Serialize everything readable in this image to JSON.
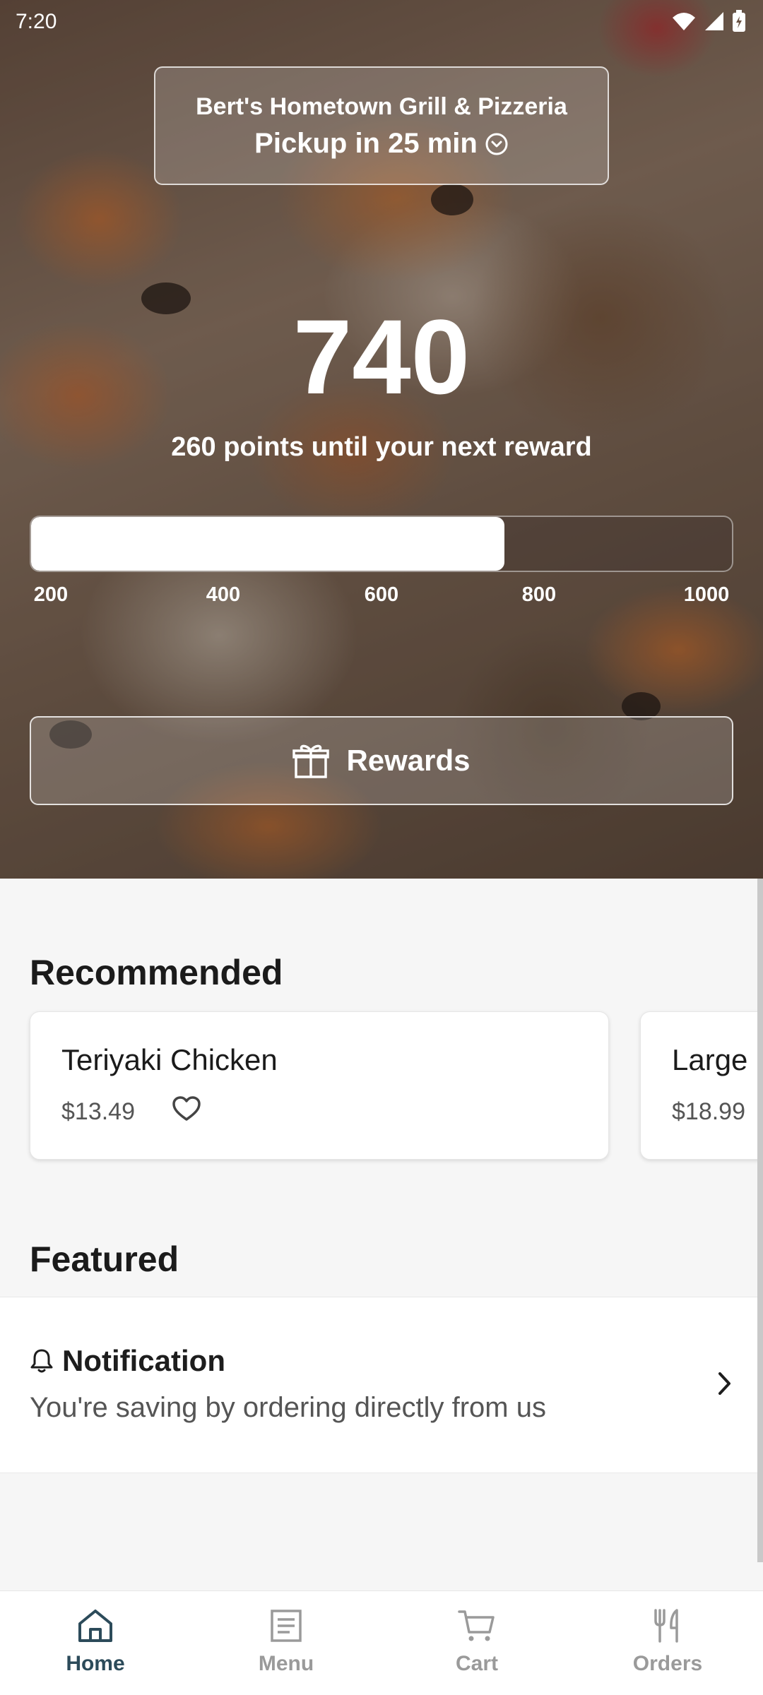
{
  "status_bar": {
    "time": "7:20"
  },
  "store": {
    "name": "Bert's Hometown Grill & Pizzeria",
    "pickup": "Pickup in 25 min"
  },
  "loyalty": {
    "points": "740",
    "subtitle": "260 points until your next reward",
    "progress": {
      "current": 740,
      "min": 200,
      "max": 1000
    },
    "ticks": [
      "200",
      "400",
      "600",
      "800",
      "1000"
    ]
  },
  "rewards_button": {
    "label": "Rewards"
  },
  "recommended": {
    "title": "Recommended",
    "items": [
      {
        "name": "Teriyaki Chicken",
        "price": "$13.49"
      },
      {
        "name": "Large C",
        "price": "$18.99"
      }
    ]
  },
  "featured": {
    "title": "Featured",
    "notification": {
      "title": "Notification",
      "text": "You're saving by ordering directly from us"
    }
  },
  "bottom_nav": {
    "items": [
      {
        "label": "Home",
        "icon": "home-icon",
        "active": true
      },
      {
        "label": "Menu",
        "icon": "menu-icon",
        "active": false
      },
      {
        "label": "Cart",
        "icon": "cart-icon",
        "active": false
      },
      {
        "label": "Orders",
        "icon": "orders-icon",
        "active": false
      }
    ]
  },
  "colors": {
    "active_nav": "#2c4b5a",
    "inactive_nav": "#9a9a9a",
    "background": "#f6f6f6"
  }
}
